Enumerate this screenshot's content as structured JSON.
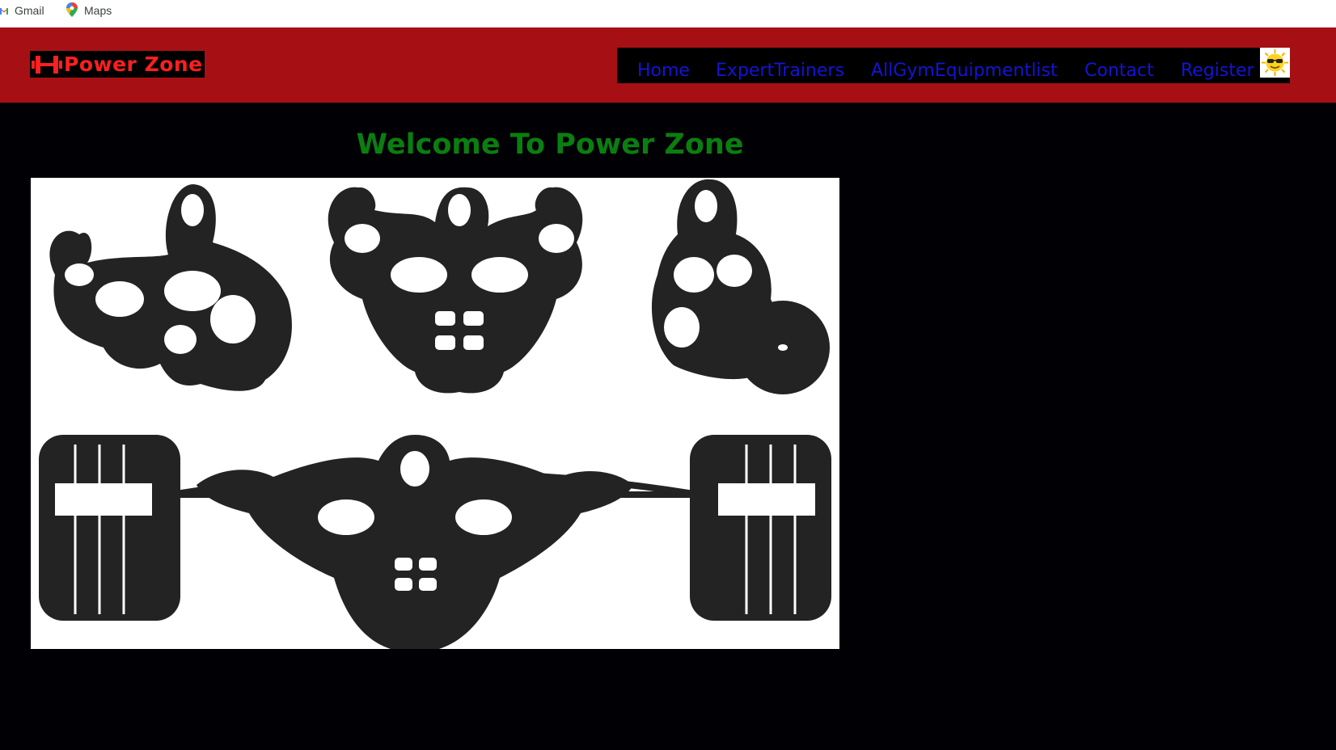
{
  "bookmarks": [
    {
      "label": "Gmail",
      "icon": "gmail-icon"
    },
    {
      "label": "Maps",
      "icon": "maps-pin-icon"
    }
  ],
  "header": {
    "logo_text": "Power Zone",
    "logo_icon": "dumbbell-icon",
    "nav": [
      {
        "label": "Home"
      },
      {
        "label": "ExpertTrainers"
      },
      {
        "label": "AllGymEquipmentlist"
      },
      {
        "label": "Contact"
      },
      {
        "label": "Register"
      }
    ],
    "avatar_icon": "sunglasses-sun-icon"
  },
  "main": {
    "welcome": "Welcome To Power Zone",
    "hero_image": "bodybuilders-illustration"
  },
  "colors": {
    "header_bg": "#a61014",
    "page_bg": "#000005",
    "logo_text": "#ff1f1f",
    "nav_link": "#1414d4",
    "welcome_text": "#0b7e10"
  }
}
